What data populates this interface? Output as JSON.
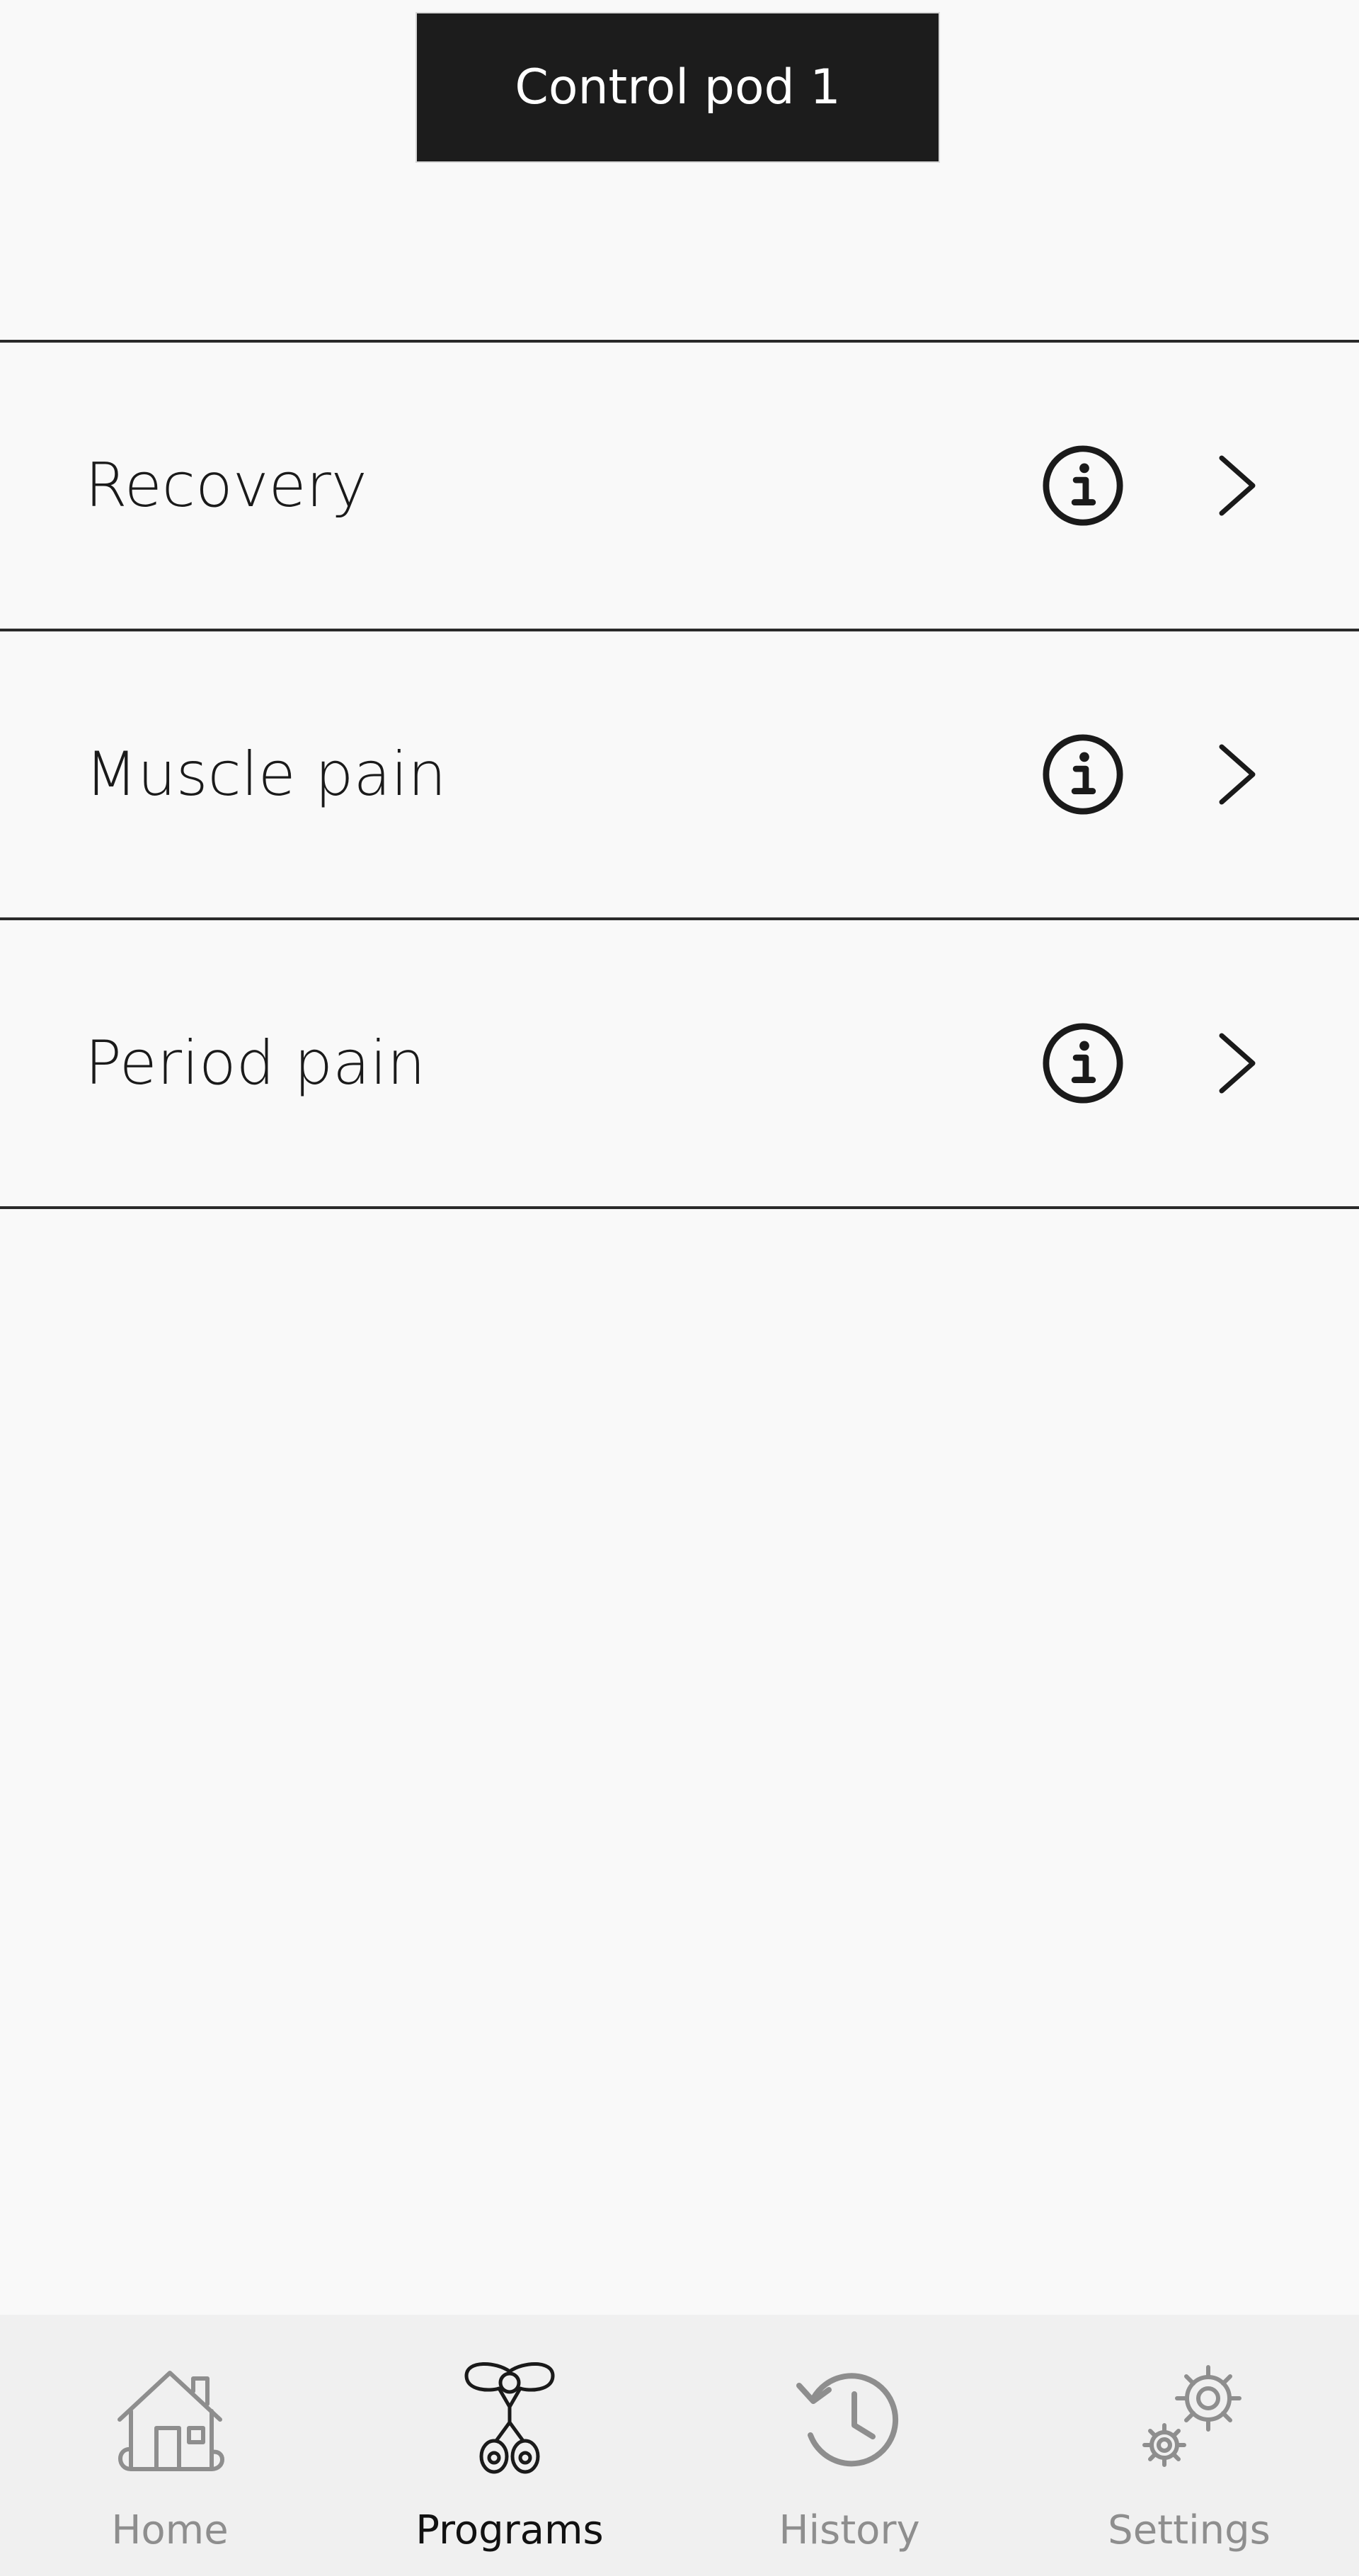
{
  "header": {
    "pod_selector_label": "Control pod 1"
  },
  "programs": [
    {
      "label": "Recovery",
      "info_icon": "info-circle-icon",
      "chevron_icon": "chevron-right-icon"
    },
    {
      "label": "Muscle pain",
      "info_icon": "info-circle-icon",
      "chevron_icon": "chevron-right-icon"
    },
    {
      "label": "Period pain",
      "info_icon": "info-circle-icon",
      "chevron_icon": "chevron-right-icon"
    }
  ],
  "tabbar": {
    "active": "Programs",
    "tabs": [
      {
        "label": "Home",
        "icon": "home-icon"
      },
      {
        "label": "Programs",
        "icon": "programs-icon"
      },
      {
        "label": "History",
        "icon": "history-icon"
      },
      {
        "label": "Settings",
        "icon": "settings-icon"
      }
    ]
  },
  "colors": {
    "background": "#f9f9f9",
    "header_button": "#1c1c1c",
    "tabbar_background": "#f0f0f0",
    "tab_active": "#111111",
    "tab_inactive": "#8e8e8e"
  }
}
